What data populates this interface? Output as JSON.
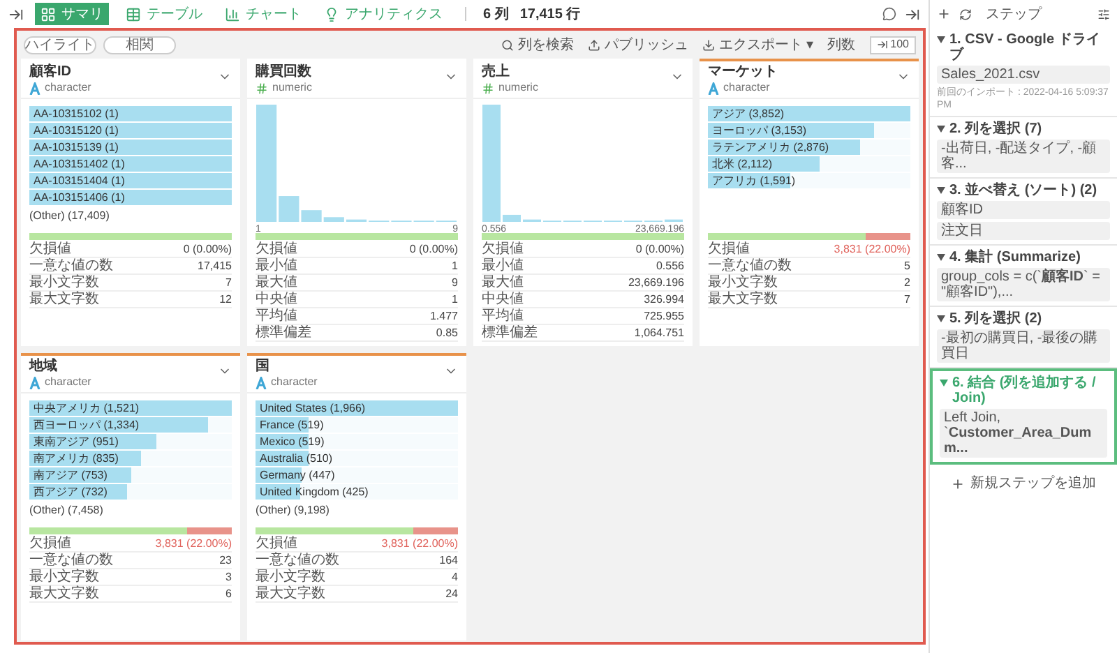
{
  "toolbar": {
    "tabs": [
      {
        "label": "サマリ",
        "selected": true
      },
      {
        "label": "テーブル",
        "selected": false
      },
      {
        "label": "チャート",
        "selected": false
      },
      {
        "label": "アナリティクス",
        "selected": false
      }
    ],
    "columns_count": "6 列",
    "rows_count": "17,415 行"
  },
  "actions": {
    "toggles": [
      "ハイライト",
      "相関"
    ],
    "search": "列を検索",
    "publish": "パブリッシュ",
    "export": "エクスポート",
    "export_caret": "▾",
    "columns_label": "列数",
    "columns_value": "100"
  },
  "cards": [
    {
      "title": "顧客ID",
      "kind": "character",
      "type": "character",
      "flagged": false,
      "bars": [
        {
          "label": "AA-10315102 (1)",
          "level": 1
        },
        {
          "label": "AA-10315120 (1)",
          "level": 1
        },
        {
          "label": "AA-10315139 (1)",
          "level": 1
        },
        {
          "label": "AA-103151402 (1)",
          "level": 1
        },
        {
          "label": "AA-103151404 (1)",
          "level": 1
        },
        {
          "label": "AA-103151406 (1)",
          "level": 1
        }
      ],
      "other": "(Other) (17,409)",
      "completeness": {
        "level": 1
      },
      "missing": {
        "label": "欠損値",
        "value": "0 (0.00%)"
      },
      "stats": [
        {
          "label": "一意な値の数",
          "value": "17,415"
        },
        {
          "label": "最小文字数",
          "value": "7"
        },
        {
          "label": "最大文字数",
          "value": "12"
        }
      ]
    },
    {
      "title": "購買回数",
      "kind": "numeric",
      "type": "numeric",
      "flagged": false,
      "xmin": "1",
      "xmax": "9",
      "completeness": {
        "level": 1
      },
      "missing": {
        "label": "欠損値",
        "value": "0 (0.00%)"
      },
      "stats": [
        {
          "label": "最小値",
          "value": "1"
        },
        {
          "label": "最大値",
          "value": "9"
        },
        {
          "label": "中央値",
          "value": "1"
        },
        {
          "label": "平均値",
          "value": "1.477"
        },
        {
          "label": "標準偏差",
          "value": "0.85"
        }
      ]
    },
    {
      "title": "売上",
      "kind": "numeric",
      "type": "numeric",
      "flagged": false,
      "xmin": "0.556",
      "xmax": "23,669.196",
      "completeness": {
        "level": 1
      },
      "missing": {
        "label": "欠損値",
        "value": "0 (0.00%)"
      },
      "stats": [
        {
          "label": "最小値",
          "value": "0.556"
        },
        {
          "label": "最大値",
          "value": "23,669.196"
        },
        {
          "label": "中央値",
          "value": "326.994"
        },
        {
          "label": "平均値",
          "value": "725.955"
        },
        {
          "label": "標準偏差",
          "value": "1,064.751"
        }
      ]
    },
    {
      "title": "マーケット",
      "kind": "character",
      "type": "character",
      "flagged": true,
      "bars": [
        {
          "label": "アジア (3,852)",
          "level": 1
        },
        {
          "label": "ヨーロッパ (3,153)",
          "level": 0.82
        },
        {
          "label": "ラテンアメリカ (2,876)",
          "level": 0.75
        },
        {
          "label": "北米 (2,112)",
          "level": 0.55
        },
        {
          "label": "アフリカ (1,591)",
          "level": 0.41
        }
      ],
      "completeness": {
        "level": 0.78
      },
      "missing": {
        "label": "欠損値",
        "value": "3,831 (22.00%)"
      },
      "stats": [
        {
          "label": "一意な値の数",
          "value": "5"
        },
        {
          "label": "最小文字数",
          "value": "2"
        },
        {
          "label": "最大文字数",
          "value": "7"
        }
      ]
    },
    {
      "title": "地域",
      "kind": "character",
      "type": "character",
      "flagged": true,
      "bars": [
        {
          "label": "中央アメリカ (1,521)",
          "level": 1
        },
        {
          "label": "西ヨーロッパ (1,334)",
          "level": 0.88
        },
        {
          "label": "東南アジア (951)",
          "level": 0.63
        },
        {
          "label": "南アメリカ (835)",
          "level": 0.55
        },
        {
          "label": "南アジア (753)",
          "level": 0.5
        },
        {
          "label": "西アジア (732)",
          "level": 0.48
        }
      ],
      "other": "(Other) (7,458)",
      "completeness": {
        "level": 0.78
      },
      "missing": {
        "label": "欠損値",
        "value": "3,831 (22.00%)"
      },
      "stats": [
        {
          "label": "一意な値の数",
          "value": "23"
        },
        {
          "label": "最小文字数",
          "value": "3"
        },
        {
          "label": "最大文字数",
          "value": "6"
        }
      ]
    },
    {
      "title": "国",
      "kind": "character",
      "type": "character",
      "flagged": true,
      "bars": [
        {
          "label": "United States (1,966)",
          "level": 1
        },
        {
          "label": "France (519)",
          "level": 0.26
        },
        {
          "label": "Mexico (519)",
          "level": 0.26
        },
        {
          "label": "Australia (510)",
          "level": 0.26
        },
        {
          "label": "Germany (447)",
          "level": 0.23
        },
        {
          "label": "United Kingdom (425)",
          "level": 0.22
        }
      ],
      "other": "(Other) (9,198)",
      "completeness": {
        "level": 0.78
      },
      "missing": {
        "label": "欠損値",
        "value": "3,831 (22.00%)"
      },
      "stats": [
        {
          "label": "一意な値の数",
          "value": "164"
        },
        {
          "label": "最小文字数",
          "value": "4"
        },
        {
          "label": "最大文字数",
          "value": "24"
        }
      ]
    }
  ],
  "steps_panel": {
    "title": "ステップ",
    "add_step": "新規ステップを追加",
    "steps": [
      {
        "title": "1. CSV - Google ドライブ",
        "selected": false,
        "items": [
          "Sales_2021.csv"
        ],
        "note": "前回のインポート : 2022-04-16 5:09:37 PM"
      },
      {
        "title": "2. 列を選択 (7)",
        "selected": false,
        "items": [
          "-出荷日, -配送タイプ, -顧客..."
        ]
      },
      {
        "title": "3. 並べ替え (ソート) (2)",
        "selected": false,
        "items": [
          "顧客ID",
          "注文日"
        ]
      },
      {
        "title": "4. 集計 (Summarize)",
        "selected": false,
        "items": [
          "group_cols = c(`**顧客ID**` = \"顧客ID\"),..."
        ]
      },
      {
        "title": "5. 列を選択 (2)",
        "selected": false,
        "items": [
          "-最初の購買日, -最後の購買日"
        ]
      },
      {
        "title": "6. 結合 (列を追加する / Join)",
        "selected": true,
        "items": [
          "Left Join, `**Customer_Area_Dumm...**"
        ]
      }
    ]
  }
}
